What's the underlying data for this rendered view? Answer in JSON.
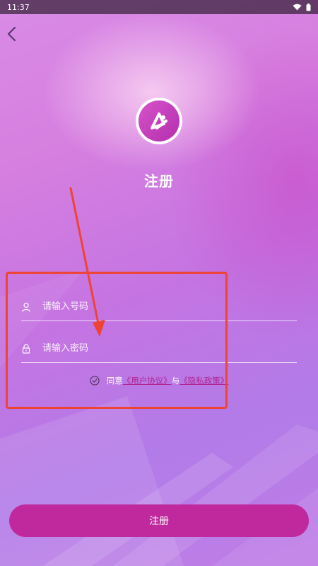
{
  "status_bar": {
    "time": "11:37"
  },
  "header": {
    "title": "注册"
  },
  "form": {
    "phone": {
      "value": "",
      "placeholder": "请输入号码",
      "icon": "user-icon"
    },
    "password": {
      "value": "",
      "placeholder": "请输入密码",
      "icon": "lock-icon"
    }
  },
  "agreement": {
    "prefix": "同意",
    "user_agreement": "《用户协议》",
    "connector": "与",
    "privacy_policy": "《隐私政策》"
  },
  "submit_label": "注册",
  "colors": {
    "accent": "#c0299e",
    "link": "#b0248f",
    "annotation": "#ee4433"
  }
}
